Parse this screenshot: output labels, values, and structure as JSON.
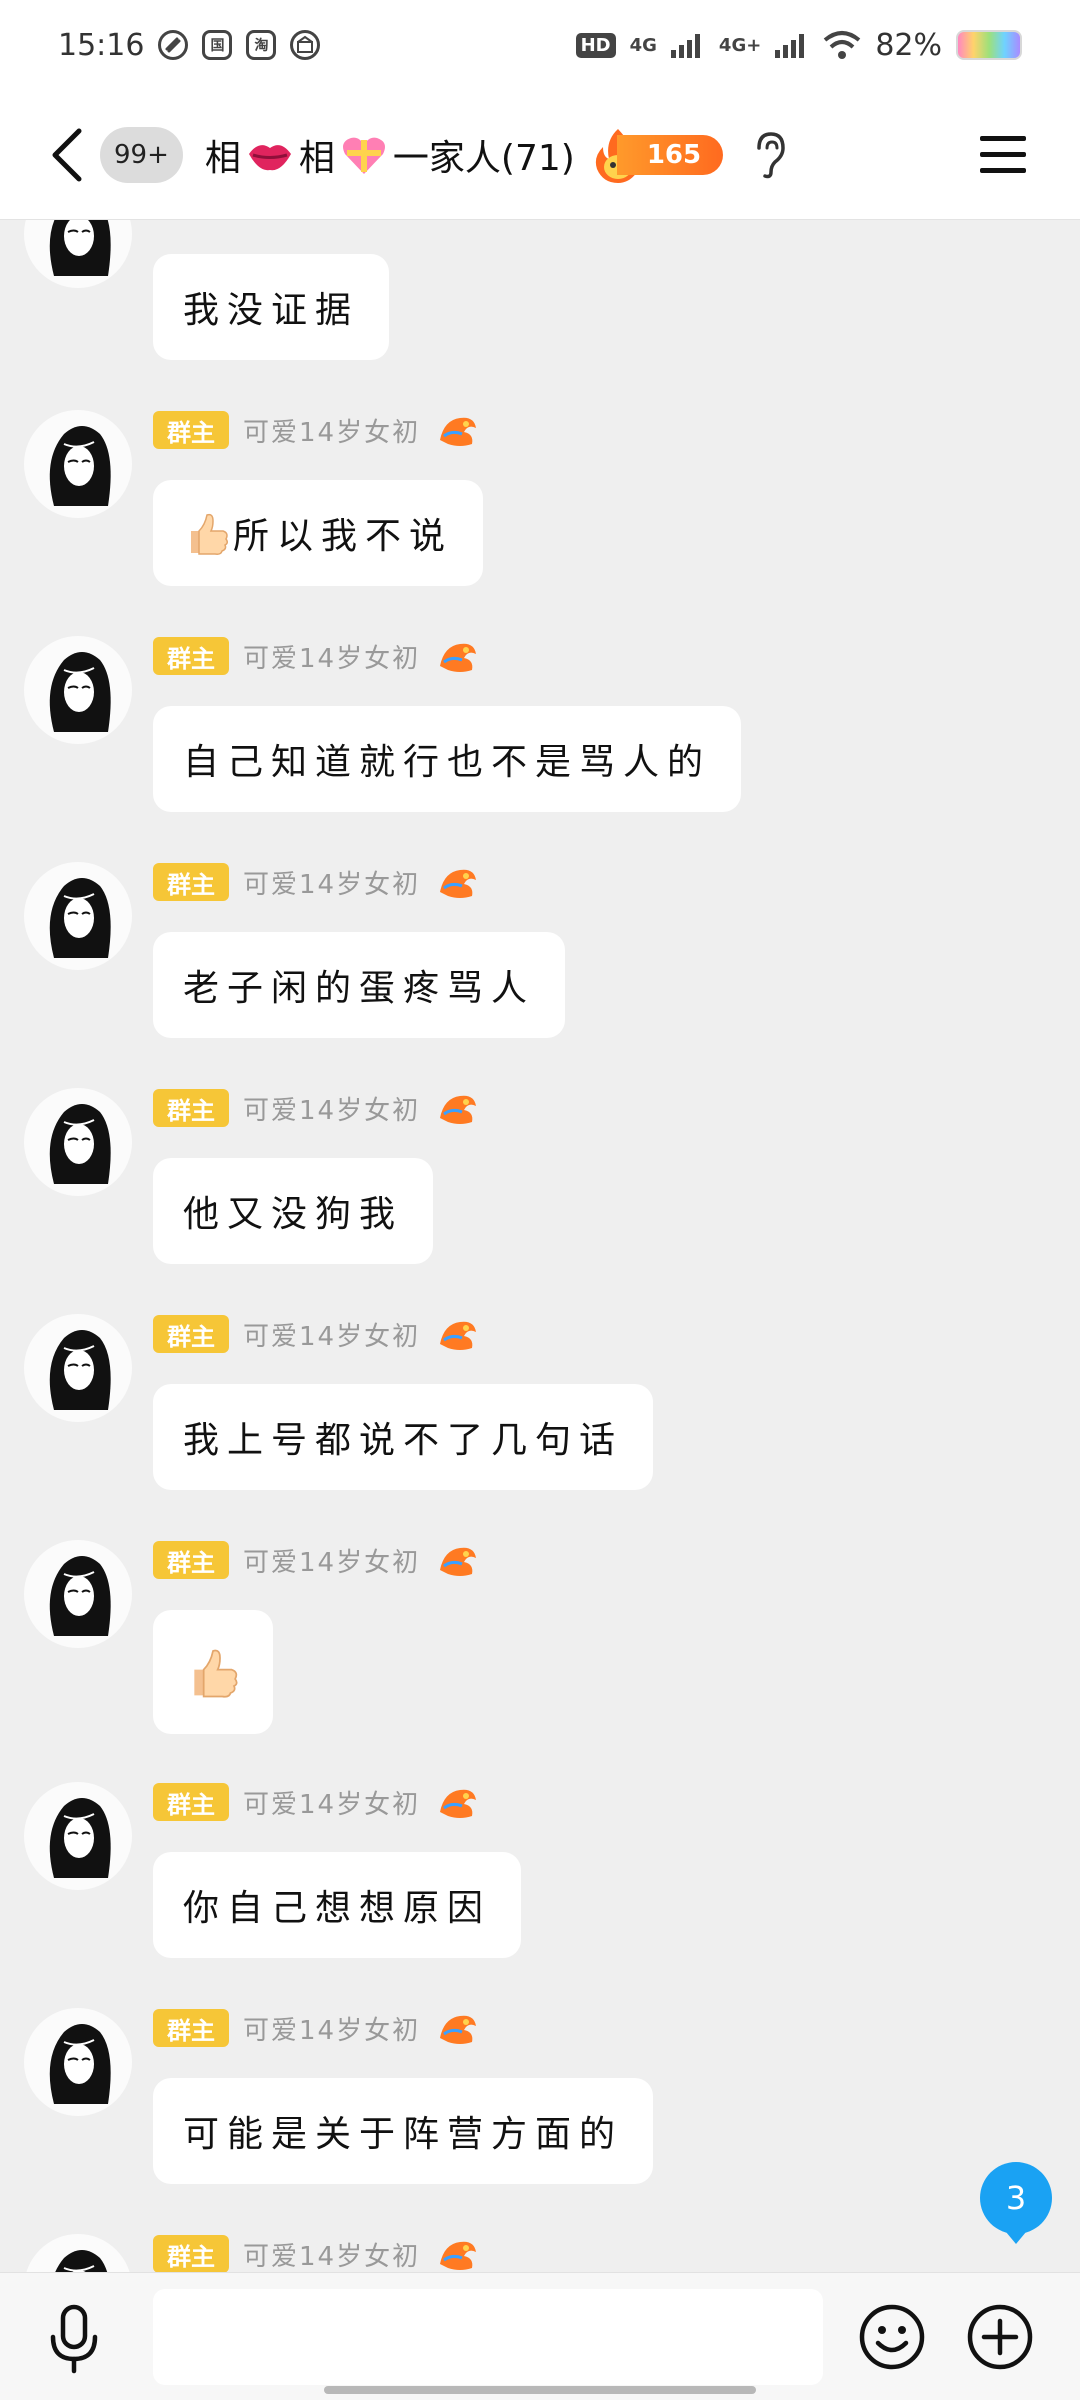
{
  "status_bar": {
    "time": "15:16",
    "network_hd": "HD",
    "network_1": "4G",
    "network_2": "4G+",
    "battery": "82%"
  },
  "header": {
    "unread_count": "99+",
    "title_part1": "相",
    "title_part2": "相",
    "title_part3": "一家人(71)",
    "fire_count": "165"
  },
  "messages": [
    {
      "badge": "群主",
      "nickname": "可爱14岁女初",
      "text": "我没证据"
    },
    {
      "badge": "群主",
      "nickname": "可爱14岁女初",
      "text": "所以我不说"
    },
    {
      "badge": "群主",
      "nickname": "可爱14岁女初",
      "text": "自己知道就行也不是骂人的"
    },
    {
      "badge": "群主",
      "nickname": "可爱14岁女初",
      "text": "老子闲的蛋疼骂人"
    },
    {
      "badge": "群主",
      "nickname": "可爱14岁女初",
      "text": "他又没狗我"
    },
    {
      "badge": "群主",
      "nickname": "可爱14岁女初",
      "text": "我上号都说不了几句话"
    },
    {
      "badge": "群主",
      "nickname": "可爱14岁女初",
      "text": ""
    },
    {
      "badge": "群主",
      "nickname": "可爱14岁女初",
      "text": "你自己想想原因"
    },
    {
      "badge": "群主",
      "nickname": "可爱14岁女初",
      "text": "可能是关于阵营方面的"
    },
    {
      "badge": "群主",
      "nickname": "可爱14岁女初",
      "text": ""
    }
  ],
  "floating_badge": "3",
  "icons": {
    "back": "chevron-left-icon",
    "lips": "lips-emoji-icon",
    "heart": "gift-heart-emoji-icon",
    "fire": "fire-icon",
    "ear": "ear-icon",
    "menu": "hamburger-menu-icon",
    "thumb": "thumbs-up-emoji-icon",
    "mic": "microphone-icon",
    "emoji": "smiley-icon",
    "plus": "plus-circle-icon"
  },
  "colors": {
    "owner_badge": "#f6c637",
    "float_badge": "#1aa2f3",
    "fire": "#ff7a22"
  }
}
